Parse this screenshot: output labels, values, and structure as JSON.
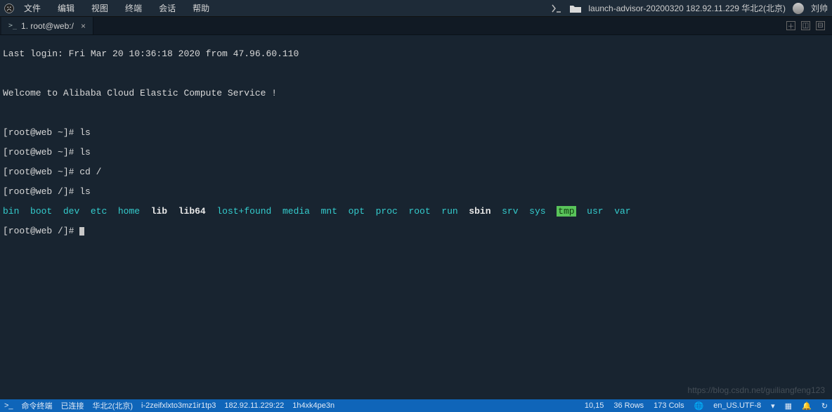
{
  "menubar": {
    "items": [
      "文件",
      "编辑",
      "视图",
      "终端",
      "会话",
      "帮助"
    ],
    "session_info": "launch-advisor-20200320 182.92.11.229 华北2(北京)",
    "user": "刘帅"
  },
  "tab": {
    "label": "1. root@web:/"
  },
  "terminal": {
    "last_login": "Last login: Fri Mar 20 10:36:18 2020 from 47.96.60.110",
    "welcome": "Welcome to Alibaba Cloud Elastic Compute Service !",
    "prompt_home": "[root@web ~]# ",
    "prompt_root": "[root@web /]# ",
    "cmd_ls": "ls",
    "cmd_cd": "cd /",
    "dirs_cyan_pre": [
      "bin",
      "boot",
      "dev",
      "etc",
      "home"
    ],
    "dirs_bold": [
      "lib",
      "lib64"
    ],
    "dirs_cyan_mid": [
      "lost+found",
      "media",
      "mnt",
      "opt",
      "proc",
      "root",
      "run"
    ],
    "dirs_bold2": [
      "sbin"
    ],
    "dirs_cyan_mid2": [
      "srv",
      "sys"
    ],
    "dirs_tmp": "tmp",
    "dirs_cyan_post": [
      "usr",
      "var"
    ]
  },
  "statusbar": {
    "label_terminal": "命令终端",
    "conn": "已连接",
    "region": "华北2(北京)",
    "instance": "i-2zeifxlxto3mz1ir1tp3",
    "ip": "182.92.11.229:22",
    "extra": "1h4xk4pe3n",
    "cursor_pos": "10,15",
    "rows": "36 Rows",
    "cols": "173 Cols",
    "encoding": "en_US.UTF-8"
  },
  "watermark": "https://blog.csdn.net/guiliangfeng123"
}
